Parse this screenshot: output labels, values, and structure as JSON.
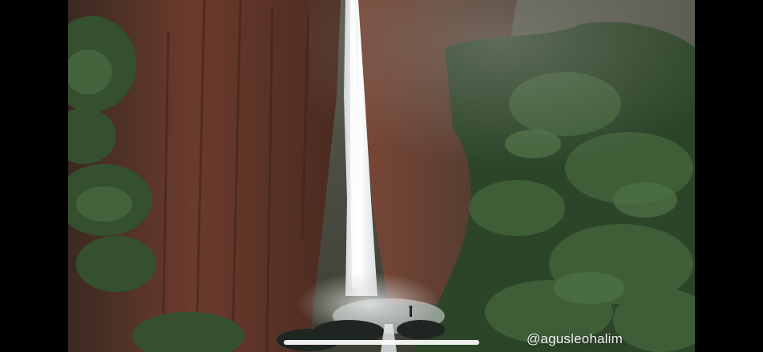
{
  "player": {
    "mode": "fullscreen-landscape",
    "scene": "waterfall-video-frame",
    "watermark": "@agusleohalim"
  },
  "colors": {
    "letterbox": "#000000",
    "rock": "#6b3b2c",
    "foliage": "#2f4a2c",
    "mist": "#c9c9c4",
    "water": "#f4f6f6"
  }
}
